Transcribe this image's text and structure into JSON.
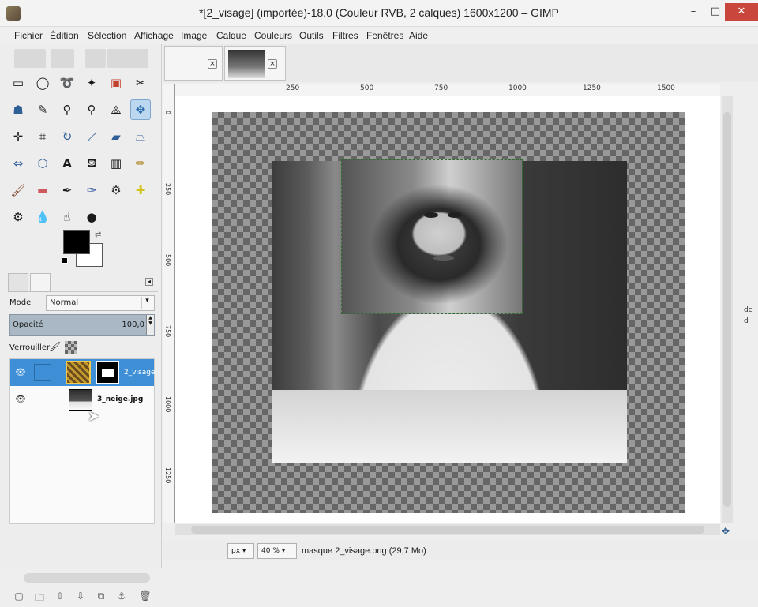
{
  "window": {
    "title": "*[2_visage] (importée)-18.0 (Couleur RVB, 2 calques) 1600x1200 – GIMP",
    "minimize": "–",
    "maximize": "□",
    "close": "✕"
  },
  "menu": [
    "Fichier",
    "Édition",
    "Sélection",
    "Affichage",
    "Image",
    "Calque",
    "Couleurs",
    "Outils",
    "Filtres",
    "Fenêtres",
    "Aide"
  ],
  "tools": [
    "rect-select",
    "ellipse-select",
    "free-select",
    "fuzzy-select",
    "color-select",
    "scissors",
    "foreground-select",
    "paths",
    "color-picker",
    "zoom",
    "measure",
    "move",
    "align",
    "crop",
    "rotate",
    "scale",
    "shear",
    "perspective",
    "flip",
    "cage",
    "text",
    "bucket-fill",
    "blend",
    "pencil",
    "paintbrush",
    "eraser",
    "airbrush",
    "ink",
    "clone",
    "heal",
    "perspective-clone",
    "blur",
    "smudge",
    "dodge-burn"
  ],
  "colors": {
    "foreground": "#000000",
    "background": "#ffffff",
    "selection_highlight": "#3f8fd6",
    "opacity_bar": "#a9b8c4"
  },
  "layers_panel": {
    "mode_label": "Mode",
    "mode_value": "Normal",
    "opacity_label": "Opacité",
    "opacity_value": "100,0",
    "lock_label": "Verrouiller :",
    "layers": [
      {
        "name": "2_visage",
        "selected": true,
        "has_mask": true
      },
      {
        "name": "3_neige.jpg",
        "selected": false,
        "has_mask": false
      }
    ]
  },
  "ruler": {
    "top_labels": [
      "250",
      "500",
      "750",
      "1000",
      "1250",
      "1500"
    ],
    "left_labels": [
      "0",
      "250",
      "500",
      "750",
      "1000",
      "1250"
    ]
  },
  "statusbar": {
    "unit": "px",
    "zoom": "40 %",
    "message": "masque 2_visage.png (29,7 Mo)"
  },
  "side_text": "dc d"
}
